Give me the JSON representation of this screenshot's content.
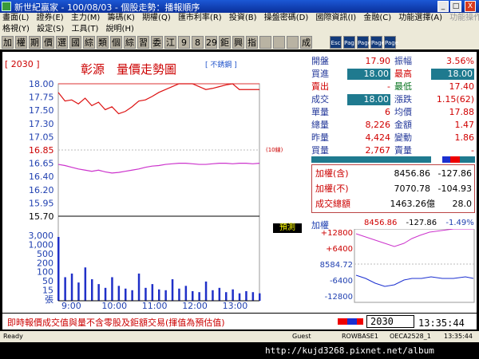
{
  "window": {
    "title": "新世紀贏家 - 100/08/03 - 個股走勢：播報順序",
    "buttons": {
      "minimize": "_",
      "maximize": "□",
      "close": "X"
    }
  },
  "menu1": [
    "畫面(L)",
    "證券(E)",
    "主力(M)",
    "籌碼(K)",
    "期權(Q)",
    "匯市利率(R)",
    "投資(B)",
    "操盤密碼(D)",
    "國際資訊(I)",
    "金融(C)",
    "功能選擇(A)",
    "功能操作(F)"
  ],
  "menu2": [
    "格視(Y)",
    "設定(S)",
    "工具(T)",
    "說明(H)"
  ],
  "toolbar": [
    "加",
    "權",
    "期",
    "價",
    "選",
    "國",
    "綜",
    "類",
    "個",
    "綜",
    "習",
    "委",
    "江",
    "9",
    "8",
    "29",
    "鉅",
    "興",
    "指",
    "",
    "",
    "",
    "成",
    "Esc",
    "Pag",
    "Page",
    "Page",
    "Page"
  ],
  "chart": {
    "code": "[ 2030 ]",
    "title": "彰源　量價走勢圖",
    "tag": "[ 不銹鋼 ]",
    "price_axis": [
      "18.00",
      "17.75",
      "17.50",
      "17.30",
      "17.05",
      "16.85",
      "16.65",
      "16.40",
      "16.20",
      "15.95",
      "15.70"
    ],
    "volume_axis": [
      "3,000",
      "1,000",
      "500",
      "200",
      "100",
      "50",
      "15",
      "張"
    ],
    "time_axis": [
      "9:00",
      "10:00",
      "11:00",
      "12:00",
      "13:00"
    ],
    "small_label": "(10線)",
    "legend": "預測"
  },
  "chart_data": {
    "type": "line",
    "x": [
      0,
      5,
      10,
      15,
      20,
      25,
      30,
      35,
      40,
      45,
      50,
      55,
      60,
      65,
      70,
      75,
      80,
      85,
      90,
      95,
      100,
      105,
      110,
      115,
      120,
      125,
      130,
      135,
      140,
      145,
      150
    ],
    "series": [
      {
        "values": [
          17.85,
          17.7,
          17.72,
          17.65,
          17.75,
          17.62,
          17.68,
          17.55,
          17.6,
          17.48,
          17.52,
          17.6,
          17.7,
          17.72,
          17.78,
          17.85,
          17.9,
          17.95,
          18.0,
          18.0,
          18.0,
          17.95,
          17.9,
          17.92,
          17.95,
          17.98,
          18.0,
          17.9,
          17.9,
          17.9,
          17.9
        ]
      },
      {
        "values": [
          16.6,
          16.58,
          16.55,
          16.52,
          16.5,
          16.48,
          16.5,
          16.47,
          16.45,
          16.46,
          16.48,
          16.5,
          16.52,
          16.55,
          16.57,
          16.58,
          16.6,
          16.61,
          16.62,
          16.62,
          16.61,
          16.6,
          16.6,
          16.61,
          16.62,
          16.62,
          16.61,
          16.62,
          16.62,
          16.61,
          16.62
        ]
      }
    ],
    "volume": [
      2200,
      300,
      400,
      180,
      600,
      250,
      150,
      90,
      300,
      120,
      80,
      60,
      400,
      90,
      150,
      70,
      60,
      250,
      80,
      120,
      50,
      40,
      200,
      60,
      90,
      40,
      70,
      30,
      50,
      40,
      30
    ],
    "ylim": [
      15.7,
      18.0
    ]
  },
  "quote": {
    "open_label": "開盤",
    "open": "17.90",
    "range_label": "振幅",
    "range": "3.56%",
    "bid_label": "買進",
    "bid": "18.00",
    "high_label": "最高",
    "high": "18.00",
    "ask_label": "賣出",
    "ask": "-",
    "low_label": "最低",
    "low": "17.40",
    "last_label": "成交",
    "last": "18.00",
    "chg_label": "漲跌",
    "chg": "1.15(62)",
    "unit_label": "單量",
    "unit": "6",
    "avg_label": "均價",
    "avg": "17.88",
    "vol_label": "總量",
    "vol": "8,226",
    "amt_label": "金額",
    "amt": "1.47",
    "yvol_label": "昨量",
    "yvol": "4,424",
    "ratio_label": "變動",
    "ratio": "1.86",
    "buyvol_label": "買量",
    "buyvol": "2,767",
    "sellvol_label": "賣量",
    "sellvol": "-"
  },
  "index": {
    "incl_label": "加權(含)",
    "incl": "8456.86",
    "incl_chg": "-127.86",
    "excl_label": "加權(不)",
    "excl": "7070.78",
    "excl_chg": "-104.93",
    "turnover_label": "成交總額",
    "turnover": "1463.26億",
    "turnover_chg": "28.0"
  },
  "mini": {
    "label": "加權",
    "value": "8456.86",
    "chg": "-127.86",
    "pct": "-1.49%",
    "axis": [
      "+12800",
      "+6400",
      "8584.72",
      "-6400",
      "-12800"
    ]
  },
  "bottom": {
    "info": "即時報價成交值與量不含零股及鉅額交易(揮值為預估值)",
    "code": "2030",
    "clock": "13:35:44"
  },
  "status": {
    "ready": "Ready",
    "guest": "Guest",
    "server": "ROWBASE1",
    "conn": "OECA2528_1",
    "time": "13:35:44"
  },
  "watermark": "http://kujd3268.pixnet.net/album"
}
